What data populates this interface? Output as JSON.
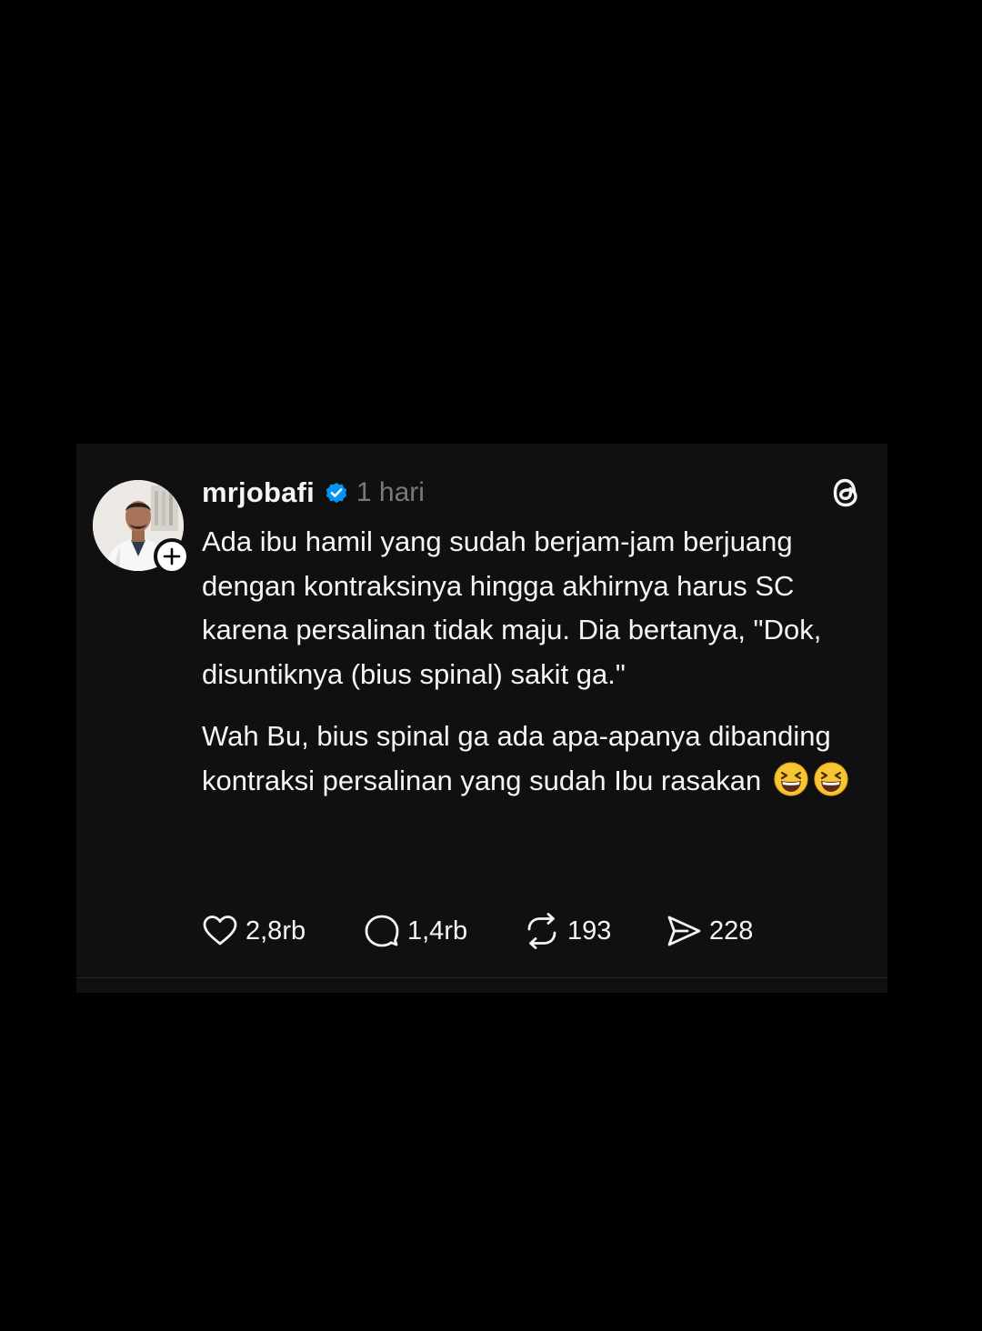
{
  "post": {
    "username": "mrjobafi",
    "time": "1 hari",
    "paragraphs": [
      "Ada ibu hamil yang sudah berjam-jam berjuang dengan kontraksinya hingga akhirnya harus SC karena persalinan tidak maju. Dia bertanya, \"Dok, disuntiknya (bius spinal) sakit ga.\"",
      "Wah Bu, bius spinal ga ada apa-apanya dibanding kontraksi persalinan yang sudah Ibu rasakan"
    ],
    "emoji": [
      "laughing-face",
      "laughing-face"
    ],
    "avatar_icon": "profile-photo",
    "follow_icon": "plus-icon",
    "verified_icon": "verified-badge-icon",
    "app_icon": "threads-logo-icon"
  },
  "actions": {
    "likes": "2,8rb",
    "replies": "1,4rb",
    "reposts": "193",
    "shares": "228"
  },
  "colors": {
    "background": "#000000",
    "card": "#101010",
    "text": "#f3f5f7",
    "muted": "#7a7a7a",
    "verified": "#0095f6"
  }
}
